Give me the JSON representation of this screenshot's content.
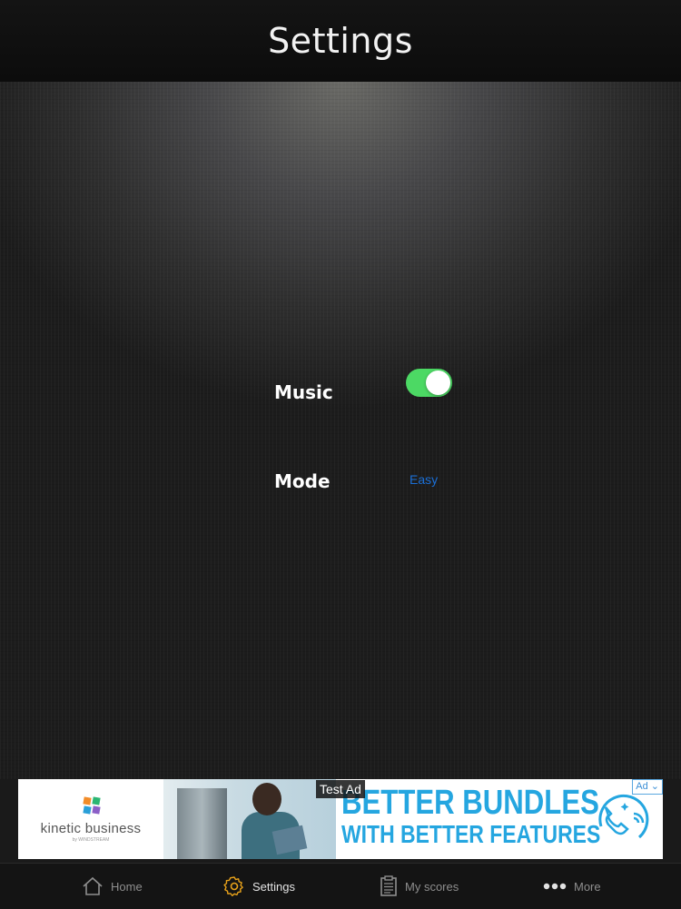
{
  "header": {
    "title": "Settings"
  },
  "settings": {
    "music_label": "Music",
    "music_enabled": true,
    "mode_label": "Mode",
    "mode_value": "Easy"
  },
  "ad": {
    "test_label": "Test Ad",
    "tag": "Ad",
    "brand": "kinetic business",
    "brand_sub": "by WINDSTREAM",
    "headline_1": "BETTER BUNDLES",
    "headline_2": "WITH BETTER FEATURES"
  },
  "tabs": [
    {
      "label": "Home",
      "icon": "home-icon",
      "active": false
    },
    {
      "label": "Settings",
      "icon": "gear-icon",
      "active": true
    },
    {
      "label": "My scores",
      "icon": "clipboard-icon",
      "active": false
    },
    {
      "label": "More",
      "icon": "more-dots-icon",
      "active": false
    }
  ],
  "colors": {
    "toggle_on": "#4cd964",
    "active_tab_icon": "#e8a21a",
    "mode_link": "#1b6fd6",
    "ad_headline": "#25a6e0"
  }
}
